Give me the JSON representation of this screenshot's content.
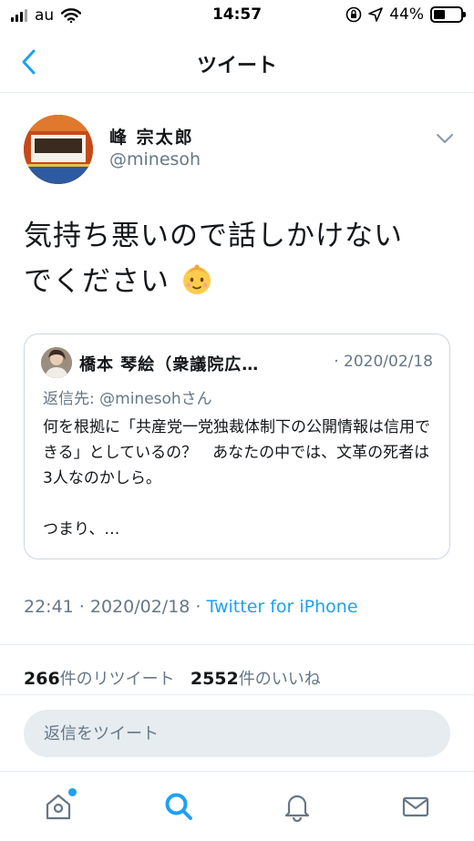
{
  "status_bar": {
    "carrier": "au",
    "time": "14:57",
    "battery_percent": "44%",
    "battery_level": 0.44
  },
  "nav": {
    "title": "ツイート",
    "back_icon": "chevron-left-icon"
  },
  "tweet": {
    "author_name": "峰 宗太郎",
    "author_handle": "@minesoh",
    "text_line1": "気持ち悪いので話しかけない",
    "text_line2": "でください",
    "emoji_icon": "baby-face-emoji-icon",
    "timestamp": "22:41 · 2020/02/18 · ",
    "source": "Twitter for iPhone",
    "retweet_count": "266",
    "retweet_label": "件のリツイート",
    "like_count": "2552",
    "like_label": "件のいいね"
  },
  "quoted_tweet": {
    "author_name": "橋本 琴絵（衆議院広…",
    "date": "· 2020/02/18",
    "reply_to": "返信先: @minesohさん",
    "text": "何を根拠に「共産党一党独裁体制下の公開情報は信用できる」としているの？　あなたの中では、文革の死者は3人なのかしら。\n\nつまり、…"
  },
  "reply": {
    "placeholder": "返信をツイート"
  },
  "tab_bar": {
    "items": [
      "home-icon",
      "search-icon",
      "notifications-icon",
      "messages-icon"
    ],
    "accent": "#1da1f2"
  },
  "colors": {
    "accent": "#1da1f2",
    "secondary_text": "#657786"
  }
}
